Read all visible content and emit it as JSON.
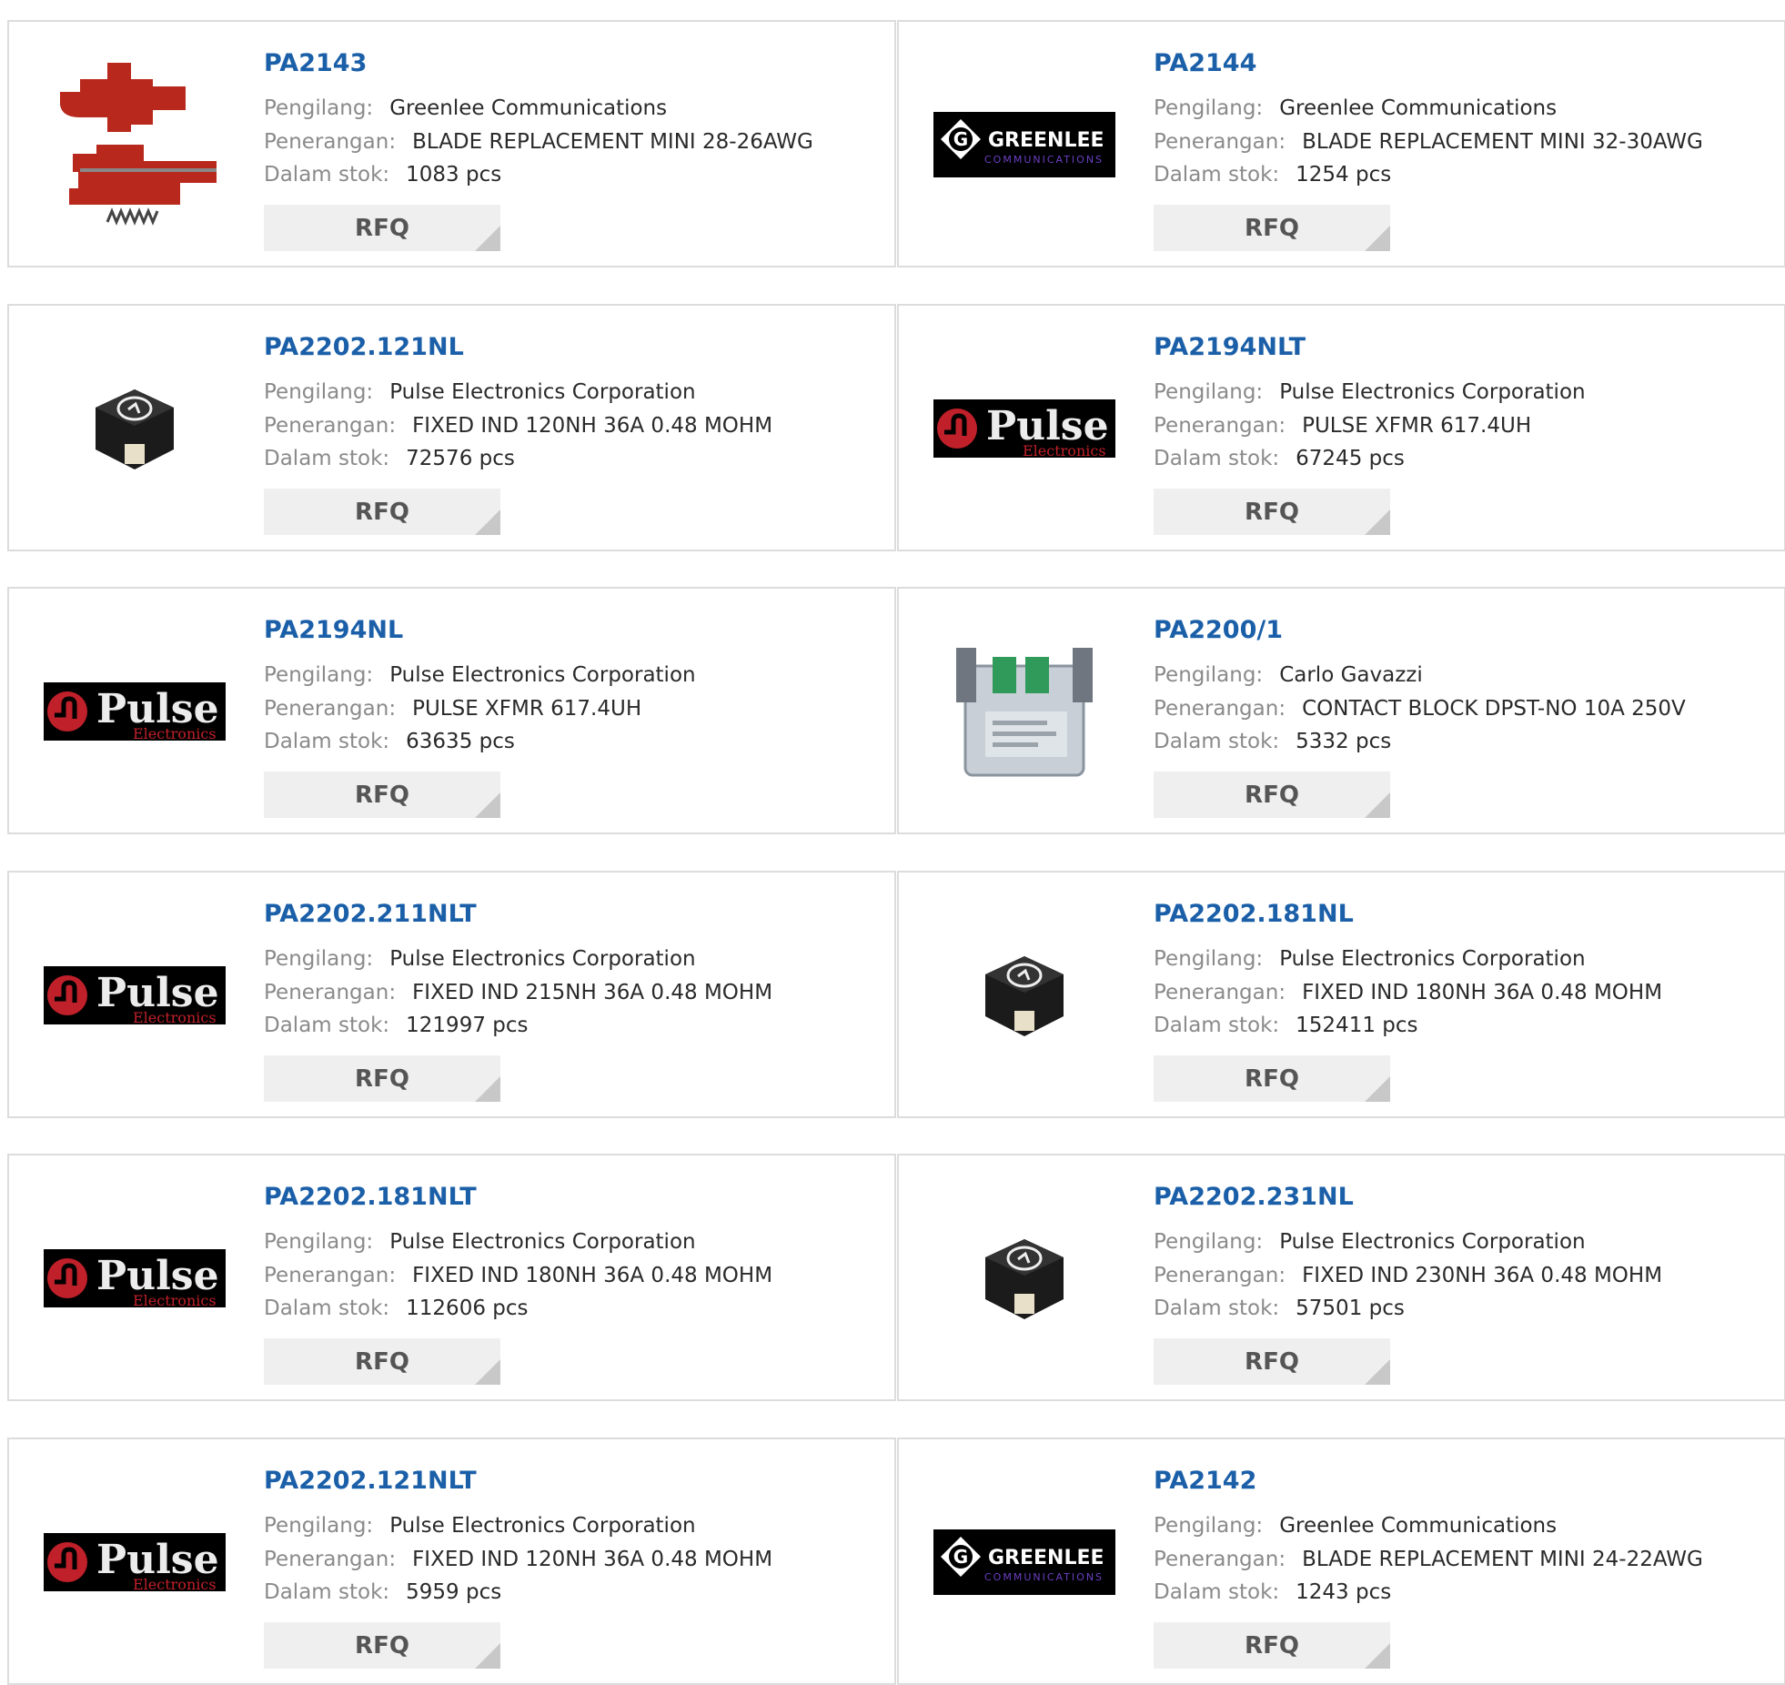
{
  "labels": {
    "manufacturer": "Pengilang:",
    "description": "Penerangan:",
    "stock": "Dalam stok:",
    "rfq": "RFQ"
  },
  "products": [
    {
      "part": "PA2143",
      "manufacturer": "Greenlee Communications",
      "description": "BLADE REPLACEMENT MINI 28-26AWG",
      "stock": "1083 pcs",
      "image": "red-blade-part-icon"
    },
    {
      "part": "PA2144",
      "manufacturer": "Greenlee Communications",
      "description": "BLADE REPLACEMENT MINI 32-30AWG",
      "stock": "1254 pcs",
      "image": "greenlee-logo",
      "logo_text": "GREENLEE",
      "logo_subtext": "COMMUNICATIONS"
    },
    {
      "part": "PA2202.121NL",
      "manufacturer": "Pulse Electronics Corporation",
      "description": "FIXED IND 120NH 36A 0.48 MOHM",
      "stock": "72576 pcs",
      "image": "inductor-chip-icon"
    },
    {
      "part": "PA2194NLT",
      "manufacturer": "Pulse Electronics Corporation",
      "description": "PULSE XFMR 617.4UH",
      "stock": "67245 pcs",
      "image": "pulse-logo",
      "logo_text": "Pulse",
      "logo_subtext": "Electronics"
    },
    {
      "part": "PA2194NL",
      "manufacturer": "Pulse Electronics Corporation",
      "description": "PULSE XFMR 617.4UH",
      "stock": "63635 pcs",
      "image": "pulse-logo",
      "logo_text": "Pulse",
      "logo_subtext": "Electronics"
    },
    {
      "part": "PA2200/1",
      "manufacturer": "Carlo Gavazzi",
      "description": "CONTACT BLOCK DPST-NO 10A 250V",
      "stock": "5332 pcs",
      "image": "contact-block-icon"
    },
    {
      "part": "PA2202.211NLT",
      "manufacturer": "Pulse Electronics Corporation",
      "description": "FIXED IND 215NH 36A 0.48 MOHM",
      "stock": "121997 pcs",
      "image": "pulse-logo",
      "logo_text": "Pulse",
      "logo_subtext": "Electronics"
    },
    {
      "part": "PA2202.181NL",
      "manufacturer": "Pulse Electronics Corporation",
      "description": "FIXED IND 180NH 36A 0.48 MOHM",
      "stock": "152411 pcs",
      "image": "inductor-chip-icon"
    },
    {
      "part": "PA2202.181NLT",
      "manufacturer": "Pulse Electronics Corporation",
      "description": "FIXED IND 180NH 36A 0.48 MOHM",
      "stock": "112606 pcs",
      "image": "pulse-logo",
      "logo_text": "Pulse",
      "logo_subtext": "Electronics"
    },
    {
      "part": "PA2202.231NL",
      "manufacturer": "Pulse Electronics Corporation",
      "description": "FIXED IND 230NH 36A 0.48 MOHM",
      "stock": "57501 pcs",
      "image": "inductor-chip-icon"
    },
    {
      "part": "PA2202.121NLT",
      "manufacturer": "Pulse Electronics Corporation",
      "description": "FIXED IND 120NH 36A 0.48 MOHM",
      "stock": "5959 pcs",
      "image": "pulse-logo",
      "logo_text": "Pulse",
      "logo_subtext": "Electronics"
    },
    {
      "part": "PA2142",
      "manufacturer": "Greenlee Communications",
      "description": "BLADE REPLACEMENT MINI 24-22AWG",
      "stock": "1243 pcs",
      "image": "greenlee-logo",
      "logo_text": "GREENLEE",
      "logo_subtext": "COMMUNICATIONS"
    }
  ],
  "colors": {
    "part_link": "#1a5fa8",
    "label": "#8a8a8a",
    "value": "#2a2a2a",
    "card_border": "#dcdcdc",
    "rfq_bg": "#efefef",
    "pulse_red": "#c0202a",
    "greenlee_purple": "#6a3fc0"
  }
}
